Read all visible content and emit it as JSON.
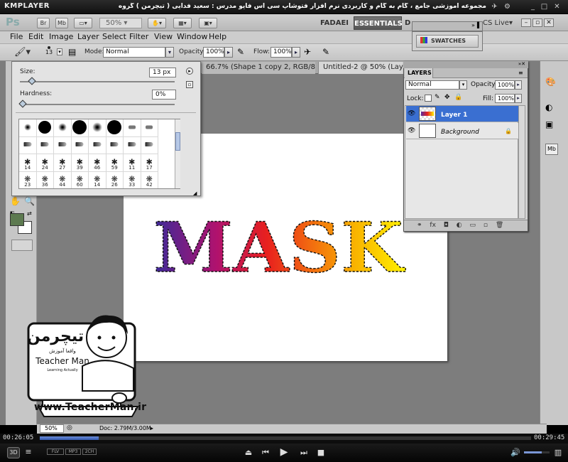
{
  "player": {
    "name": "KMPLAYER",
    "caption": "مجموعه آموزشی جامع ، گام به گام و کاربردی نرم افزار فتوشاپ سی اس فایو  مدرس : سعید فدایی ( تیچرمن ) گروه آموزشی پادشاه گرافیست ها",
    "elapsed": "00:26:05",
    "total": "00:29:45",
    "progress_fraction": 0.12,
    "badges": [
      "FLV",
      "MP3",
      "2CH"
    ],
    "volume_fraction": 0.7
  },
  "app": {
    "logo": "Ps",
    "br_label": "Br",
    "mb_label": "Mb",
    "zoom": "50%",
    "workspaces": {
      "fadaei": "FADAEI",
      "essentials": "ESSENTIALS",
      "d": "D"
    },
    "cs_live": "CS Live"
  },
  "menu": [
    "File",
    "Edit",
    "Image",
    "Layer",
    "Select",
    "Filter",
    "View",
    "Window",
    "Help"
  ],
  "options": {
    "brush_size": "13",
    "mode_label": "Mode:",
    "mode_value": "Normal",
    "opacity_label": "Opacity:",
    "opacity_value": "100%",
    "flow_label": "Flow:",
    "flow_value": "100%"
  },
  "tabs": [
    "66.7% (Shape 1 copy 2, RGB/8) *",
    "Untitled-2 @ 50% (Layer"
  ],
  "brush_picker": {
    "size_label": "Size:",
    "size_value": "13 px",
    "hardness_label": "Hardness:",
    "hardness_value": "0%",
    "size_fraction": 0.06,
    "hardness_fraction": 0.0,
    "brushes": [
      "",
      "",
      "",
      "",
      "",
      "",
      "",
      "",
      "",
      "",
      "",
      "",
      "",
      "",
      "",
      "",
      "14",
      "24",
      "27",
      "39",
      "46",
      "59",
      "11",
      "17",
      "23",
      "36",
      "44",
      "60",
      "14",
      "26",
      "33",
      "42"
    ]
  },
  "canvas": {
    "text": "MASK",
    "gradient": [
      "#3b2a9a",
      "#b0126e",
      "#e8201e",
      "#f26a10",
      "#f9b400",
      "#fff200"
    ]
  },
  "swatches": {
    "title": "SWATCHES"
  },
  "layers": {
    "title": "LAYERS",
    "blend": "Normal",
    "opacity_label": "Opacity:",
    "opacity_value": "100%",
    "lock_label": "Lock:",
    "fill_label": "Fill:",
    "fill_value": "100%",
    "items": [
      {
        "name": "Layer 1",
        "selected": true
      },
      {
        "name": "Background",
        "selected": false
      }
    ]
  },
  "status": {
    "zoom": "50%",
    "doc": "Doc: 2.79M/3.00M"
  },
  "logo": {
    "brand_fa": "تیچرمن",
    "subtitle_fa": "واقعا آموزش",
    "brand_en": "Teacher Man",
    "tagline": "Learning Actually",
    "url": "www.TeacherMan.ir"
  },
  "colors": {
    "foreground": "#5d7a50",
    "background": "#ffffff",
    "selection": "#3a6fd1"
  }
}
